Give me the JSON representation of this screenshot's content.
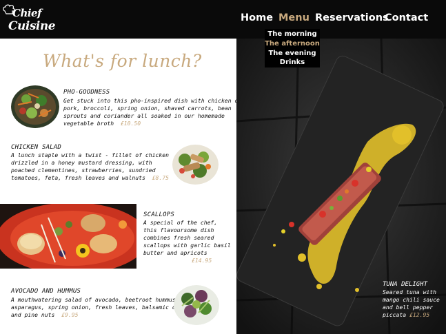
{
  "logo": {
    "line1": "Chief",
    "line2": "Cuisine"
  },
  "nav": [
    {
      "label": "Home"
    },
    {
      "label": "Menu"
    },
    {
      "label": "Reservations"
    },
    {
      "label": "Contact"
    }
  ],
  "submenu": [
    {
      "label": "The morning"
    },
    {
      "label": "The afternoon"
    },
    {
      "label": "The evening"
    },
    {
      "label": "Drinks"
    }
  ],
  "heading": "What's for lunch?",
  "items": [
    {
      "title": "PHO-GOODNESS",
      "lines": [
        "Get stuck into this pho-inspired dish with chicken or",
        "pork, broccoli, spring onion, shaved carrots, bean",
        "sprouts and coriander all soaked in our homemade"
      ],
      "last_line": "vegetable broth",
      "price": "£10.50"
    },
    {
      "title": "CHICKEN SALAD",
      "lines": [
        "A lunch staple with a twist - fillet of chicken",
        "drizzled in a honey mustard dressing, with",
        "poached clementines, strawberries, sundried"
      ],
      "last_line": "tomatoes, feta, fresh leaves and walnuts",
      "price": "£8.75"
    },
    {
      "title": "SCALLOPS",
      "lines": [
        "A special of the chef,",
        "this flavoursome dish",
        "combines fresh seared",
        "scallops with garlic basil",
        "butter and apricots"
      ],
      "price": "£14.95"
    },
    {
      "title": "AVOCADO AND HUMMUS",
      "lines": [
        "A mouthwatering salad of avocado, beetroot hummus,",
        "asparagus, spring onion, fresh leaves, balsamic dressing"
      ],
      "last_line": "and pine nuts",
      "price": "£9.95"
    }
  ],
  "featured": {
    "title": "TUNA DELIGHT",
    "lines": [
      "Seared tuna with",
      "mango chili sauce",
      "and bell pepper"
    ],
    "last_line": "piccata",
    "price": "£12.95"
  }
}
